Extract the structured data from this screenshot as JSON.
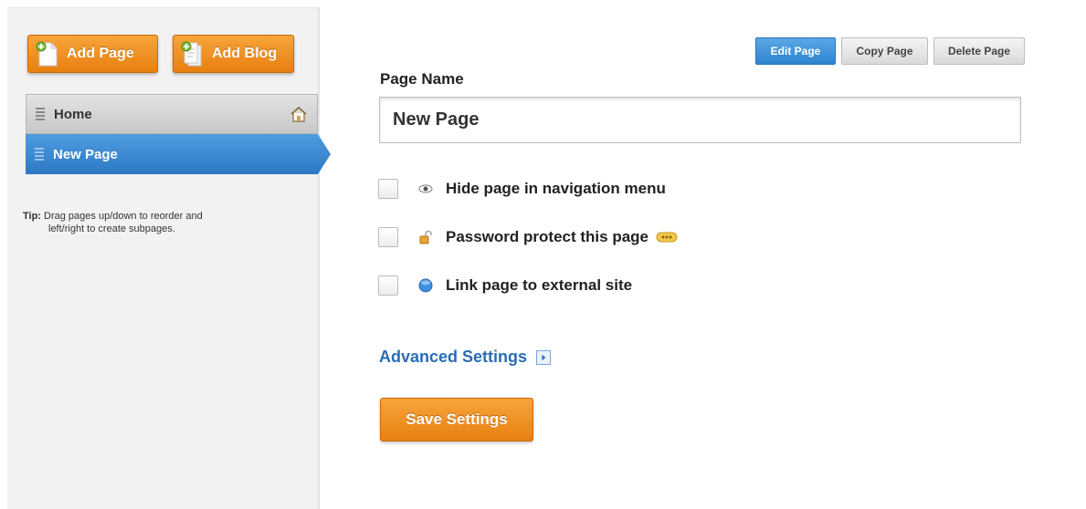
{
  "sidebar": {
    "add_page_label": "Add Page",
    "add_blog_label": "Add Blog",
    "pages": [
      {
        "label": "Home",
        "selected": false
      },
      {
        "label": "New Page",
        "selected": true
      }
    ],
    "tip_label": "Tip:",
    "tip_text": "Drag pages up/down to reorder and",
    "tip_text_2": "left/right to create subpages."
  },
  "actions": {
    "edit_label": "Edit Page",
    "copy_label": "Copy Page",
    "delete_label": "Delete Page"
  },
  "form": {
    "page_name_label": "Page Name",
    "page_name_value": "New Page",
    "options": [
      {
        "label": "Hide page in navigation menu",
        "icon": "eye-icon",
        "checked": false
      },
      {
        "label": "Password protect this page",
        "icon": "lock-icon",
        "checked": false
      },
      {
        "label": "Link page to external site",
        "icon": "globe-icon",
        "checked": false
      }
    ],
    "advanced_label": "Advanced Settings",
    "save_label": "Save Settings"
  },
  "colors": {
    "accent_orange": "#e8800f",
    "accent_blue": "#2f83cf",
    "link_blue": "#2a6db5"
  }
}
